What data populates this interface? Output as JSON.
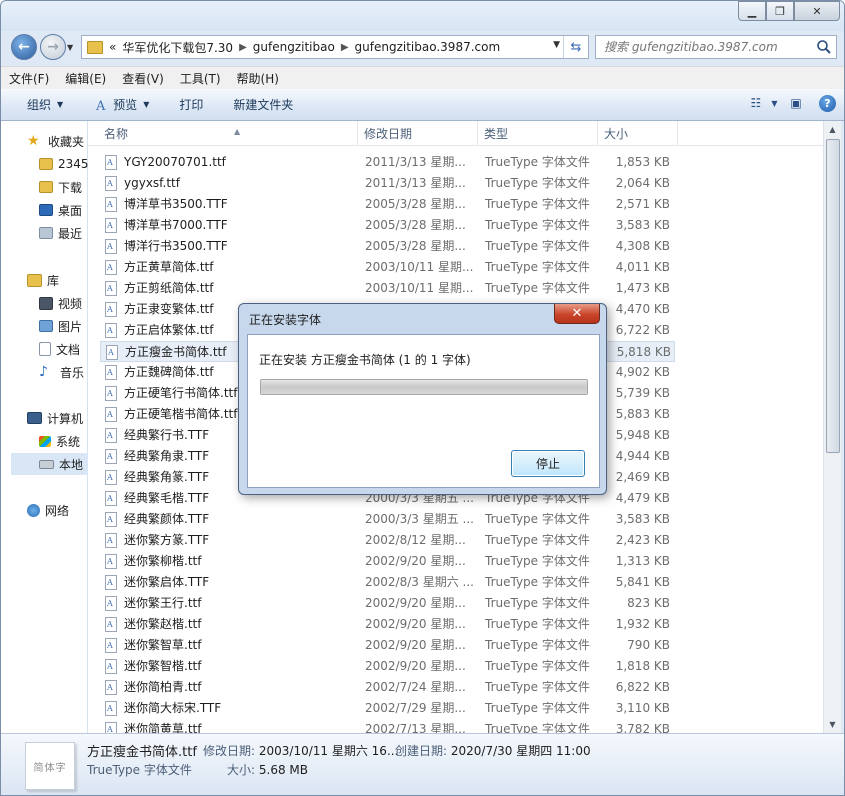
{
  "address": {
    "prefix": "«",
    "crumbs": [
      "华军优化下载包7.30",
      "gufengzitibao",
      "gufengzitibao.3987.com"
    ]
  },
  "search": {
    "placeholder": "搜索 gufengzitibao.3987.com"
  },
  "menu": [
    "文件(F)",
    "编辑(E)",
    "查看(V)",
    "工具(T)",
    "帮助(H)"
  ],
  "toolbar": {
    "organize": "组织",
    "preview": "预览",
    "print": "打印",
    "new_folder": "新建文件夹",
    "help": "?"
  },
  "nav": {
    "favorites": "收藏夹",
    "fav_items": [
      "2345",
      "下载",
      "桌面",
      "最近"
    ],
    "library": "库",
    "lib_items": [
      "视频",
      "图片",
      "文档",
      "音乐"
    ],
    "computer": "计算机",
    "comp_items": [
      "系统",
      "本地"
    ],
    "network": "网络"
  },
  "columns": {
    "name": "名称",
    "date": "修改日期",
    "type": "类型",
    "size": "大小"
  },
  "files": [
    {
      "name": "YGY20070701.ttf",
      "date": "2011/3/13 星期...",
      "type": "TrueType 字体文件",
      "size": "1,853 KB"
    },
    {
      "name": "ygyxsf.ttf",
      "date": "2011/3/13 星期...",
      "type": "TrueType 字体文件",
      "size": "2,064 KB"
    },
    {
      "name": "博洋草书3500.TTF",
      "date": "2005/3/28 星期...",
      "type": "TrueType 字体文件",
      "size": "2,571 KB"
    },
    {
      "name": "博洋草书7000.TTF",
      "date": "2005/3/28 星期...",
      "type": "TrueType 字体文件",
      "size": "3,583 KB"
    },
    {
      "name": "博洋行书3500.TTF",
      "date": "2005/3/28 星期...",
      "type": "TrueType 字体文件",
      "size": "4,308 KB"
    },
    {
      "name": "方正黄草简体.ttf",
      "date": "2003/10/11 星期...",
      "type": "TrueType 字体文件",
      "size": "4,011 KB"
    },
    {
      "name": "方正剪纸简体.ttf",
      "date": "2003/10/11 星期...",
      "type": "TrueType 字体文件",
      "size": "1,473 KB"
    },
    {
      "name": "方正隶变繁体.ttf",
      "date": "",
      "type": "",
      "size": "4,470 KB"
    },
    {
      "name": "方正启体繁体.ttf",
      "date": "",
      "type": "",
      "size": "6,722 KB"
    },
    {
      "name": "方正瘦金书简体.ttf",
      "date": "",
      "type": "",
      "size": "5,818 KB"
    },
    {
      "name": "方正魏碑简体.ttf",
      "date": "",
      "type": "",
      "size": "4,902 KB"
    },
    {
      "name": "方正硬笔行书简体.ttf",
      "date": "",
      "type": "",
      "size": "5,739 KB"
    },
    {
      "name": "方正硬笔楷书简体.ttf",
      "date": "",
      "type": "",
      "size": "5,883 KB"
    },
    {
      "name": "经典繁行书.TTF",
      "date": "",
      "type": "",
      "size": "5,948 KB"
    },
    {
      "name": "经典繁角隶.TTF",
      "date": "",
      "type": "",
      "size": "4,944 KB"
    },
    {
      "name": "经典繁角篆.TTF",
      "date": "",
      "type": "",
      "size": "2,469 KB"
    },
    {
      "name": "经典繁毛楷.TTF",
      "date": "2000/3/3 星期五 ...",
      "type": "TrueType 字体文件",
      "size": "4,479 KB"
    },
    {
      "name": "经典繁颜体.TTF",
      "date": "2000/3/3 星期五 ...",
      "type": "TrueType 字体文件",
      "size": "3,583 KB"
    },
    {
      "name": "迷你繁方篆.TTF",
      "date": "2002/8/12 星期...",
      "type": "TrueType 字体文件",
      "size": "2,423 KB"
    },
    {
      "name": "迷你繁柳楷.ttf",
      "date": "2002/9/20 星期...",
      "type": "TrueType 字体文件",
      "size": "1,313 KB"
    },
    {
      "name": "迷你繁启体.TTF",
      "date": "2002/8/3 星期六 ...",
      "type": "TrueType 字体文件",
      "size": "5,841 KB"
    },
    {
      "name": "迷你繁王行.ttf",
      "date": "2002/9/20 星期...",
      "type": "TrueType 字体文件",
      "size": "823 KB"
    },
    {
      "name": "迷你繁赵楷.ttf",
      "date": "2002/9/20 星期...",
      "type": "TrueType 字体文件",
      "size": "1,932 KB"
    },
    {
      "name": "迷你繁智草.ttf",
      "date": "2002/9/20 星期...",
      "type": "TrueType 字体文件",
      "size": "790 KB"
    },
    {
      "name": "迷你繁智楷.ttf",
      "date": "2002/9/20 星期...",
      "type": "TrueType 字体文件",
      "size": "1,818 KB"
    },
    {
      "name": "迷你简柏青.ttf",
      "date": "2002/7/24 星期...",
      "type": "TrueType 字体文件",
      "size": "6,822 KB"
    },
    {
      "name": "迷你简大标宋.TTF",
      "date": "2002/7/29 星期...",
      "type": "TrueType 字体文件",
      "size": "3,110 KB"
    },
    {
      "name": "迷你简黄草.ttf",
      "date": "2002/7/13 星期...",
      "type": "TrueType 字体文件",
      "size": "3,782 KB"
    }
  ],
  "selected_index": 9,
  "details": {
    "thumb_text": "简体字",
    "filename": "方正瘦金书简体.ttf",
    "modified_label": "修改日期:",
    "modified": "2003/10/11 星期六 16...",
    "created_label": "创建日期:",
    "created": "2020/7/30 星期四 11:00",
    "type": "TrueType 字体文件",
    "size_label": "大小:",
    "size": "5.68 MB"
  },
  "dialog": {
    "title": "正在安装字体",
    "message": "正在安装 方正瘦金书简体 (1 的 1 字体)",
    "progress": 1.0,
    "stop": "停止",
    "close": "✕"
  }
}
